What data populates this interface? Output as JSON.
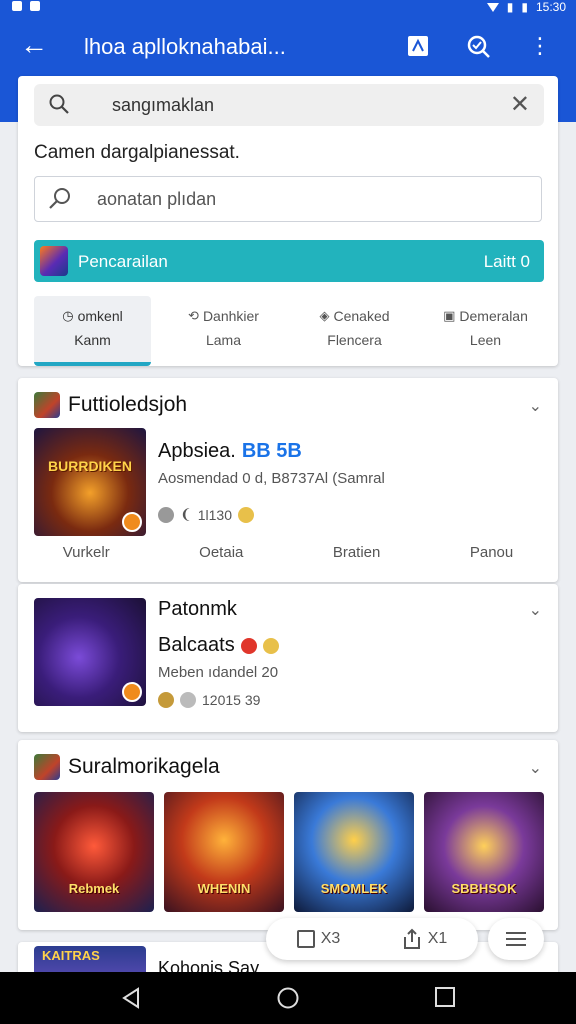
{
  "status": {
    "time": "15:30"
  },
  "appbar": {
    "title": "lhoa aplloknahabai..."
  },
  "search": {
    "value": "sangımaklan"
  },
  "subtitle": "Camen dargalpianessat.",
  "search2": {
    "placeholder": "aonatan plıdan"
  },
  "banner": {
    "label": "Pencarailan",
    "right": "Laitt 0"
  },
  "tabs": [
    {
      "l1": "omkenl",
      "l2": "Kanm",
      "icon": "clock-icon"
    },
    {
      "l1": "Danhkier",
      "l2": "Lama",
      "icon": "refresh-icon"
    },
    {
      "l1": "Cenaked",
      "l2": "Flencera",
      "icon": "tag-icon"
    },
    {
      "l1": "Demeralan",
      "l2": "Leen",
      "icon": "calendar-icon"
    }
  ],
  "featured": {
    "header": "Futtioledsjoh",
    "image_caption": "BURRDIKEN",
    "name": "Apbsiea.",
    "price": "BB 5B",
    "subtitle": "Aosmendad 0 d, B8737Al (Samral",
    "stats": "1l130",
    "actions": [
      "Vurkelr",
      "Oetaia",
      "Bratien",
      "Panou"
    ]
  },
  "card2": {
    "title": "Patonmk",
    "name": "Balcaats",
    "subtitle": "Meben ıdandel 20",
    "stats": "12015 39"
  },
  "carousel": {
    "header": "Suralmorikagela",
    "tiles": [
      {
        "caption": "Rebmek",
        "icon": "sword-hero-art"
      },
      {
        "caption": "WHENIN",
        "icon": "soldiers-art"
      },
      {
        "caption": "SMOMLEK",
        "icon": "warrior-art"
      },
      {
        "caption": "SBBHSOK",
        "icon": "fantasy-art"
      }
    ]
  },
  "card4": {
    "thumb_caption": "KAITRAS",
    "title": "Kohonis Say"
  },
  "floating": {
    "a": "X3",
    "b": "X1"
  },
  "colors": {
    "primary": "#1a56d6",
    "accent_teal": "#22b3bd",
    "price_blue": "#1a73e8"
  }
}
